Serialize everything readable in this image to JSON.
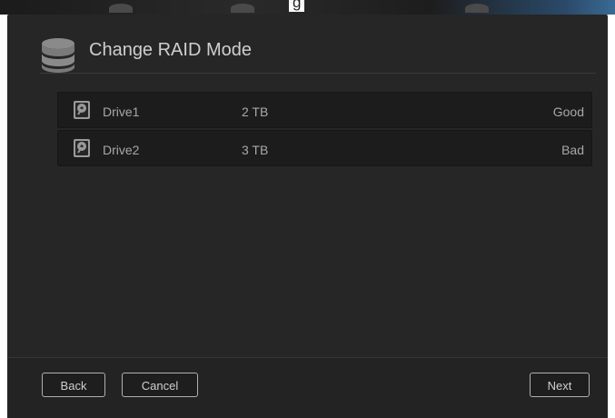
{
  "background": {
    "partial_text": "g"
  },
  "dialog": {
    "title": "Change RAID Mode",
    "icon": "database-icon"
  },
  "drives": [
    {
      "name": "Drive1",
      "size": "2 TB",
      "status": "Good",
      "icon": "hard-drive-icon"
    },
    {
      "name": "Drive2",
      "size": "3 TB",
      "status": "Bad",
      "icon": "hard-drive-icon"
    }
  ],
  "footer": {
    "back_label": "Back",
    "cancel_label": "Cancel",
    "next_label": "Next"
  },
  "colors": {
    "dialog_bg": "#262626",
    "row_bg": "#1c1c1c",
    "text": "#a8a8a8",
    "title": "#cfcfcf",
    "button_border": "#b0b0b0"
  }
}
